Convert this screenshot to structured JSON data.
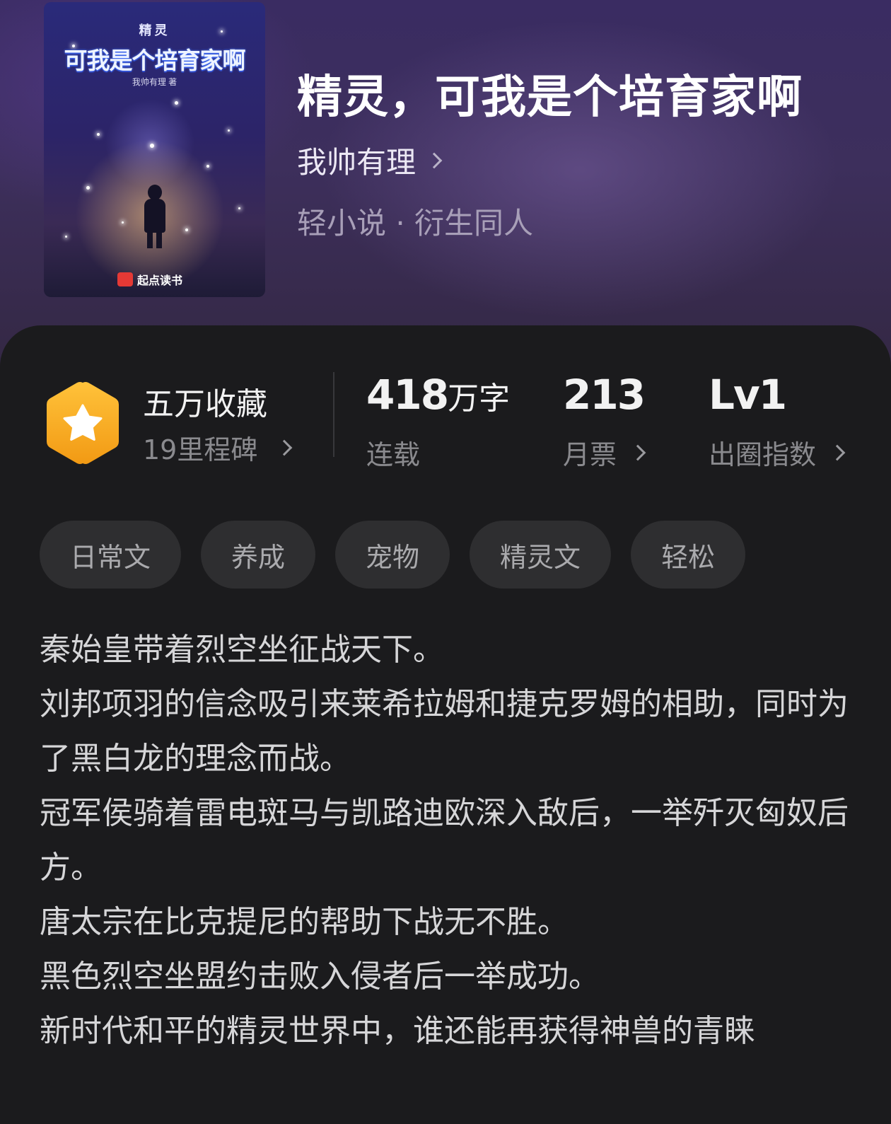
{
  "cover": {
    "badge": "精灵",
    "title": "可我是个培育家啊",
    "author": "我帅有理 著",
    "publisher": "起点读书"
  },
  "book": {
    "title": "精灵，可我是个培育家啊",
    "author": "我帅有理",
    "genre": "轻小说 · 衍生同人"
  },
  "stats": {
    "collection": {
      "title": "五万收藏",
      "sub": "19里程碑"
    },
    "words": {
      "number": "418",
      "unit": "万字",
      "sub": "连载"
    },
    "tickets": {
      "number": "213",
      "sub": "月票"
    },
    "index": {
      "number": "Lv1",
      "sub": "出圈指数"
    }
  },
  "tags": [
    "日常文",
    "养成",
    "宠物",
    "精灵文",
    "轻松"
  ],
  "description": [
    "秦始皇带着烈空坐征战天下。",
    "刘邦项羽的信念吸引来莱希拉姆和捷克罗姆的相助，同时为了黑白龙的理念而战。",
    "冠军侯骑着雷电斑马与凯路迪欧深入敌后，一举歼灭匈奴后方。",
    "唐太宗在比克提尼的帮助下战无不胜。",
    "黑色烈空坐盟约击败入侵者后一举成功。",
    "新时代和平的精灵世界中，谁还能再获得神兽的青睐"
  ],
  "colors": {
    "header_bg": "#3a2c62",
    "panel_bg": "#1b1b1d",
    "badge_orange": "#f6a623",
    "tag_bg": "#2e2e30"
  },
  "icons": {
    "badge": "star-hexagon-icon",
    "chevron": "chevron-right-icon"
  }
}
